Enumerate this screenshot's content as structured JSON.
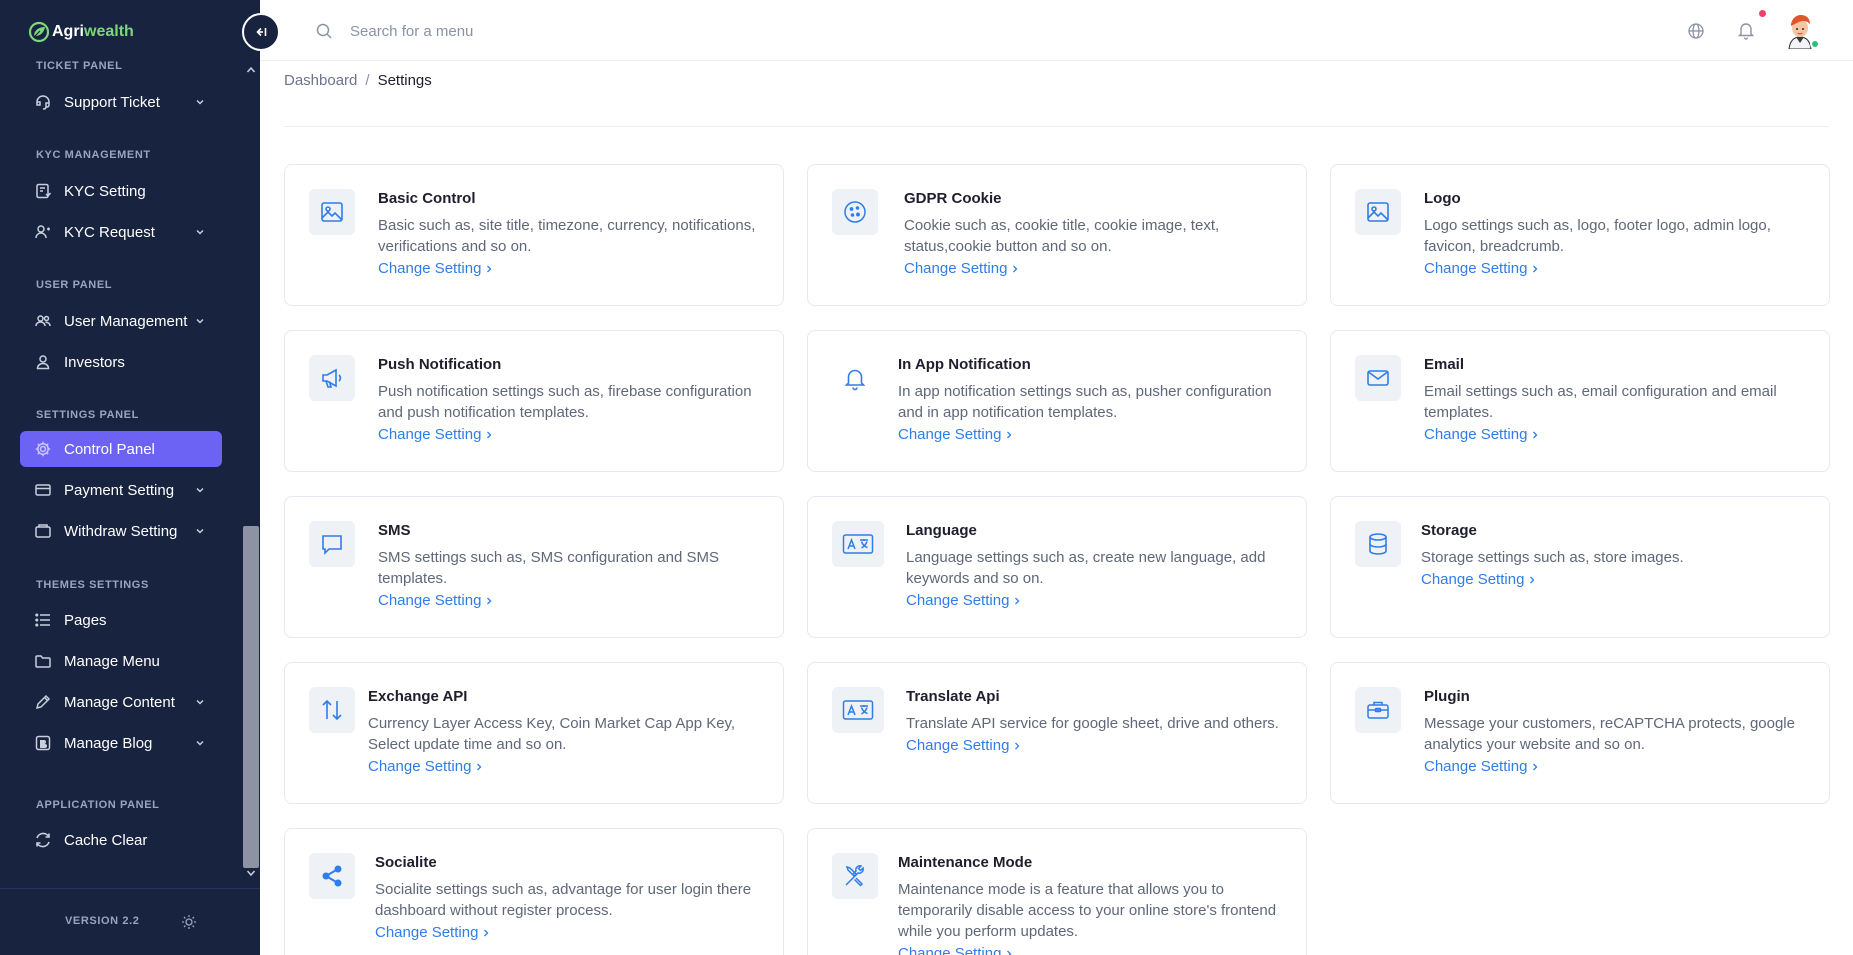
{
  "brand": {
    "part1": "Agri",
    "part2": "wealth"
  },
  "search": {
    "placeholder": "Search for a menu"
  },
  "breadcrumb": {
    "home": "Dashboard",
    "separator": "/",
    "current": "Settings"
  },
  "sidebar": {
    "sections": [
      {
        "title": "TICKET PANEL"
      },
      {
        "title": "KYC MANAGEMENT"
      },
      {
        "title": "USER PANEL"
      },
      {
        "title": "SETTINGS PANEL"
      },
      {
        "title": "THEMES SETTINGS"
      },
      {
        "title": "APPLICATION PANEL"
      }
    ],
    "items": [
      {
        "label": "Support Ticket",
        "icon": "support-ticket-icon",
        "has_submenu": true
      },
      {
        "label": "KYC Setting",
        "icon": "kyc-setting-icon",
        "has_submenu": false
      },
      {
        "label": "KYC Request",
        "icon": "kyc-request-icon",
        "has_submenu": true
      },
      {
        "label": "User Management",
        "icon": "users-icon",
        "has_submenu": true
      },
      {
        "label": "Investors",
        "icon": "user-icon",
        "has_submenu": false
      },
      {
        "label": "Control Panel",
        "icon": "gear-icon",
        "has_submenu": false,
        "active": true
      },
      {
        "label": "Payment Setting",
        "icon": "wallet-icon",
        "has_submenu": true
      },
      {
        "label": "Withdraw Setting",
        "icon": "withdraw-icon",
        "has_submenu": true
      },
      {
        "label": "Pages",
        "icon": "list-icon",
        "has_submenu": false
      },
      {
        "label": "Manage Menu",
        "icon": "folder-icon",
        "has_submenu": false
      },
      {
        "label": "Manage Content",
        "icon": "pencil-icon",
        "has_submenu": true
      },
      {
        "label": "Manage Blog",
        "icon": "blog-icon",
        "has_submenu": true
      },
      {
        "label": "Cache Clear",
        "icon": "refresh-icon",
        "has_submenu": false
      }
    ],
    "version": "VERSION 2.2"
  },
  "cards": [
    {
      "title": "Basic Control",
      "desc": "Basic such as, site title, timezone, currency, notifications, verifications and so on.",
      "link": "Change Setting",
      "icon": "image-icon"
    },
    {
      "title": "GDPR Cookie",
      "desc": "Cookie such as, cookie title, cookie image, text, status,cookie button and so on.",
      "link": "Change Setting",
      "icon": "cookie-icon"
    },
    {
      "title": "Logo",
      "desc": "Logo settings such as, logo, footer logo, admin logo, favicon, breadcrumb.",
      "link": "Change Setting",
      "icon": "image-icon"
    },
    {
      "title": "Push Notification",
      "desc": "Push notification settings such as, firebase configuration and push notification templates.",
      "link": "Change Setting",
      "icon": "megaphone-icon"
    },
    {
      "title": "In App Notification",
      "desc": "In app notification settings such as, pusher configuration and in app notification templates.",
      "link": "Change Setting",
      "icon": "bell-icon"
    },
    {
      "title": "Email",
      "desc": "Email settings such as, email configuration and email templates.",
      "link": "Change Setting",
      "icon": "envelope-icon"
    },
    {
      "title": "SMS",
      "desc": "SMS settings such as, SMS configuration and SMS templates.",
      "link": "Change Setting",
      "icon": "chat-icon"
    },
    {
      "title": "Language",
      "desc": "Language settings such as, create new language, add keywords and so on.",
      "link": "Change Setting",
      "icon": "translate-icon"
    },
    {
      "title": "Storage",
      "desc": "Storage settings such as, store images.",
      "link": "Change Setting",
      "icon": "database-icon"
    },
    {
      "title": "Exchange API",
      "desc": "Currency Layer Access Key, Coin Market Cap App Key, Select update time and so on.",
      "link": "Change Setting",
      "icon": "exchange-icon"
    },
    {
      "title": "Translate Api",
      "desc": "Translate API service for google sheet, drive and others.",
      "link": "Change Setting",
      "icon": "translate-icon"
    },
    {
      "title": "Plugin",
      "desc": "Message your customers, reCAPTCHA protects, google analytics your website and so on.",
      "link": "Change Setting",
      "icon": "toolbox-icon"
    },
    {
      "title": "Socialite",
      "desc": "Socialite settings such as, advantage for user login there dashboard without register process.",
      "link": "Change Setting",
      "icon": "share-icon"
    },
    {
      "title": "Maintenance Mode",
      "desc": "Maintenance mode is a feature that allows you to temporarily disable access to your online store's frontend while you perform updates.",
      "link": "Change Setting",
      "icon": "tools-icon"
    }
  ],
  "colors": {
    "sidebar_bg": "#17233f",
    "active": "#6c63f4",
    "link": "#2f7de9",
    "brand_green": "#7ed67a"
  }
}
